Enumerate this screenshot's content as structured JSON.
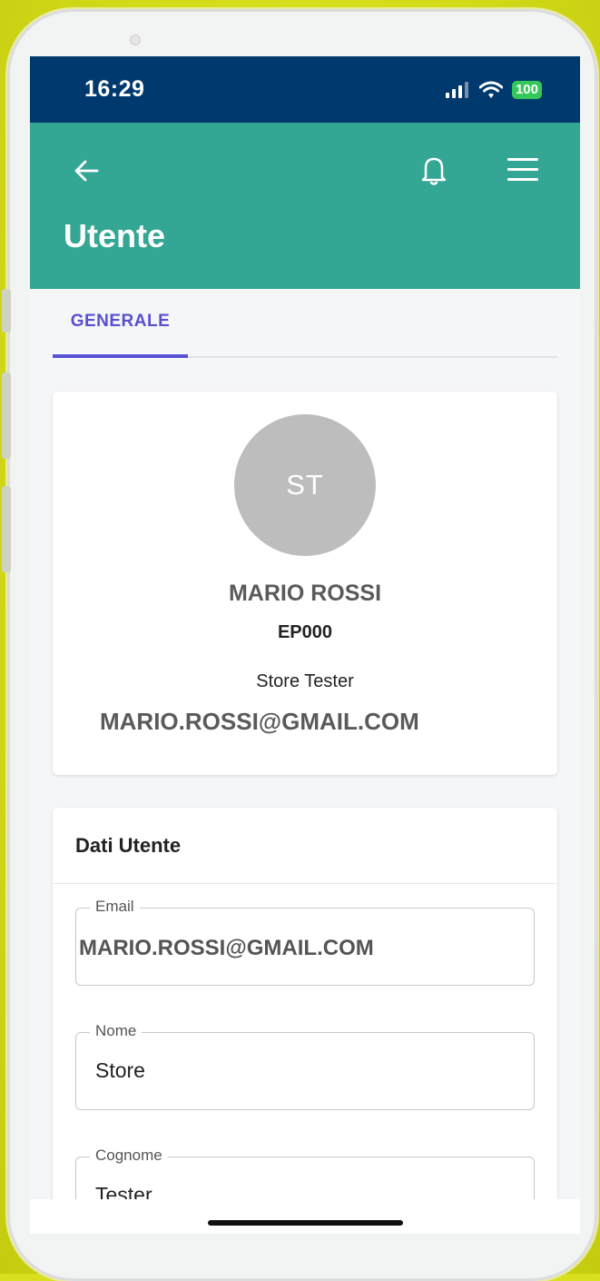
{
  "status_bar": {
    "time": "16:29",
    "battery": "100",
    "icons": [
      "signal-icon",
      "wifi-icon",
      "battery-icon"
    ]
  },
  "app_bar": {
    "title": "Utente",
    "icons": [
      "arrow-left-icon",
      "bell-icon",
      "hamburger-menu-icon"
    ],
    "color": "#33a694"
  },
  "tabs": [
    {
      "label": "GENERALE",
      "active": true
    }
  ],
  "profile": {
    "initials": "ST",
    "name": "MARIO ROSSI",
    "code": "EP000",
    "role": "Store Tester",
    "email": "MARIO.ROSSI@GMAIL.COM"
  },
  "dati_utente": {
    "title": "Dati Utente",
    "fields": [
      {
        "label": "Email",
        "value": "MARIO.ROSSI@GMAIL.COM"
      },
      {
        "label": "Nome",
        "value": "Store"
      },
      {
        "label": "Cognome",
        "value": "Tester"
      }
    ]
  },
  "colors": {
    "status_bar": "#00396d",
    "accent_tab": "#5a52d6",
    "background": "#d8df1f"
  }
}
